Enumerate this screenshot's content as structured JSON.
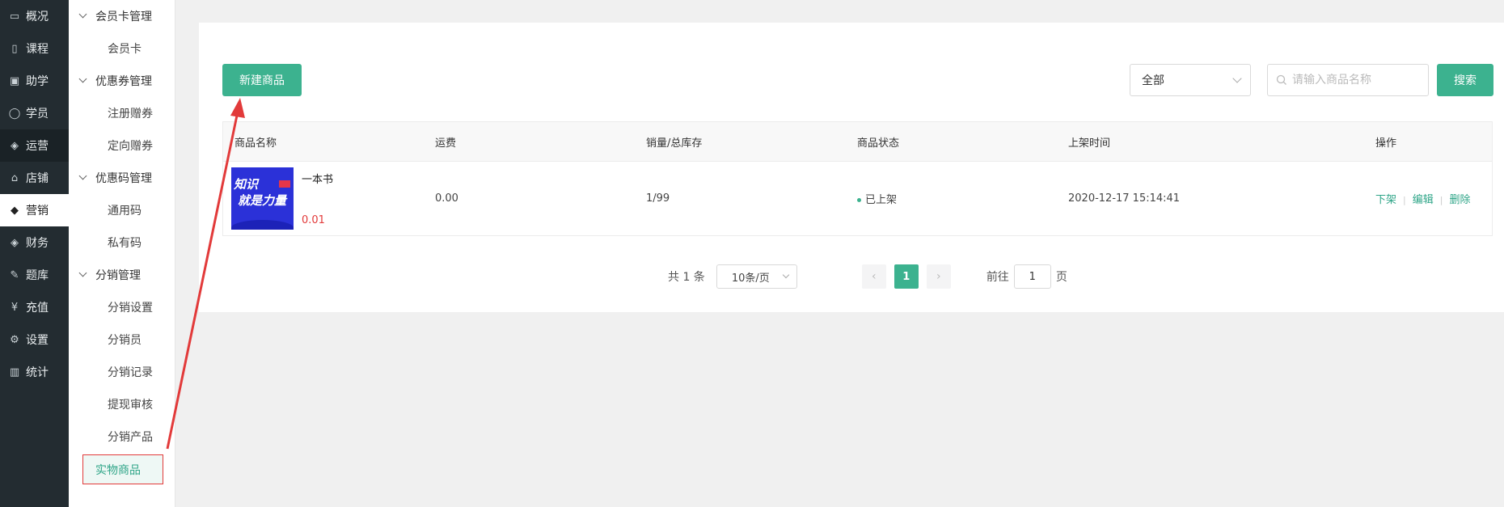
{
  "nav": {
    "items": [
      {
        "label": "概况",
        "icon": "monitor-icon"
      },
      {
        "label": "课程",
        "icon": "book-icon"
      },
      {
        "label": "助学",
        "icon": "briefcase-icon"
      },
      {
        "label": "学员",
        "icon": "user-icon"
      },
      {
        "label": "运营",
        "icon": "cube-icon"
      },
      {
        "label": "店铺",
        "icon": "store-icon"
      },
      {
        "label": "营销",
        "icon": "tag-icon"
      },
      {
        "label": "财务",
        "icon": "box-icon"
      },
      {
        "label": "题库",
        "icon": "pen-icon"
      },
      {
        "label": "充值",
        "icon": "yen-icon"
      },
      {
        "label": "设置",
        "icon": "gear-icon"
      },
      {
        "label": "统计",
        "icon": "bar-chart-icon"
      }
    ],
    "active": "营销"
  },
  "sidebar": {
    "groups": [
      {
        "label": "会员卡管理",
        "items": [
          "会员卡"
        ]
      },
      {
        "label": "优惠券管理",
        "items": [
          "注册赠券",
          "定向赠券"
        ]
      },
      {
        "label": "优惠码管理",
        "items": [
          "通用码",
          "私有码"
        ]
      },
      {
        "label": "分销管理",
        "items": [
          "分销设置",
          "分销员",
          "分销记录",
          "提现审核",
          "分销产品"
        ]
      }
    ],
    "active_item": "实物商品"
  },
  "toolbar": {
    "new_button": "新建商品",
    "filter_value": "全部",
    "search_placeholder": "请输入商品名称",
    "search_button": "搜索"
  },
  "table": {
    "headers": [
      "商品名称",
      "运费",
      "销量/总库存",
      "商品状态",
      "上架时间",
      "操作"
    ],
    "rows": [
      {
        "name": "一本书",
        "price": "0.01",
        "thumb_line1": "知识",
        "thumb_line2": "就是力量",
        "shipping": "0.00",
        "sales": "1/99",
        "status": "已上架",
        "time": "2020-12-17 15:14:41",
        "actions": [
          "下架",
          "编辑",
          "删除"
        ]
      }
    ]
  },
  "pagination": {
    "total_text": "共 1 条",
    "page_size": "10条/页",
    "current_page": "1",
    "goto_label": "前往",
    "goto_value": "1",
    "page_unit": "页"
  },
  "colors": {
    "accent": "#3cb28f",
    "nav_bg": "#232c31",
    "annotation_red": "#e23a3a",
    "price_red": "#e23a3a"
  }
}
